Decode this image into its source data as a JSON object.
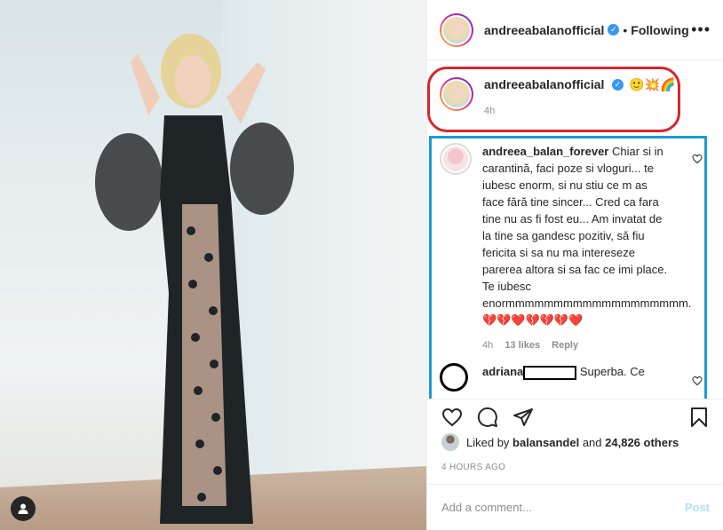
{
  "post": {
    "author": "andreeabalanofficial",
    "follow_separator": "•",
    "follow_status": "Following",
    "more_label": "•••"
  },
  "caption": {
    "username": "andreeabalanofficial",
    "emojis": "🙂💥🌈",
    "time": "4h"
  },
  "comments": [
    {
      "username": "andreea_balan_forever",
      "text": "Chiar si in carantină, faci poze si vloguri... te iubesc enorm, si nu stiu ce m as face fără tine sincer... Cred ca fara tine nu as fi fost eu... Am invatat de la tine sa gandesc pozitiv, să fiu fericita si sa nu ma intereseze parerea altora si sa fac ce imi place. Te iubesc enormmmmmmmmmmmmmmmmmmm.",
      "emojis": "💔💔❤️💔💔💔❤️",
      "time": "4h",
      "likes": "13 likes",
      "reply": "Reply"
    },
    {
      "username": "adriana",
      "text": "Superba. Ce"
    }
  ],
  "likes": {
    "prefix": "Liked by",
    "user": "balansandel",
    "and": "and",
    "count": "24,826 others"
  },
  "date": "4 HOURS AGO",
  "add_comment": {
    "placeholder": "Add a comment...",
    "post_label": "Post"
  },
  "icons": [
    "user-tag-icon",
    "heart-icon",
    "comment-icon",
    "share-icon",
    "bookmark-icon",
    "verified-icon",
    "more-icon"
  ],
  "colors": {
    "caption_highlight": "#d9262b",
    "comment_highlight": "#1a9bd7",
    "verified": "#3897f0",
    "post_disabled": "#b2dffc"
  }
}
